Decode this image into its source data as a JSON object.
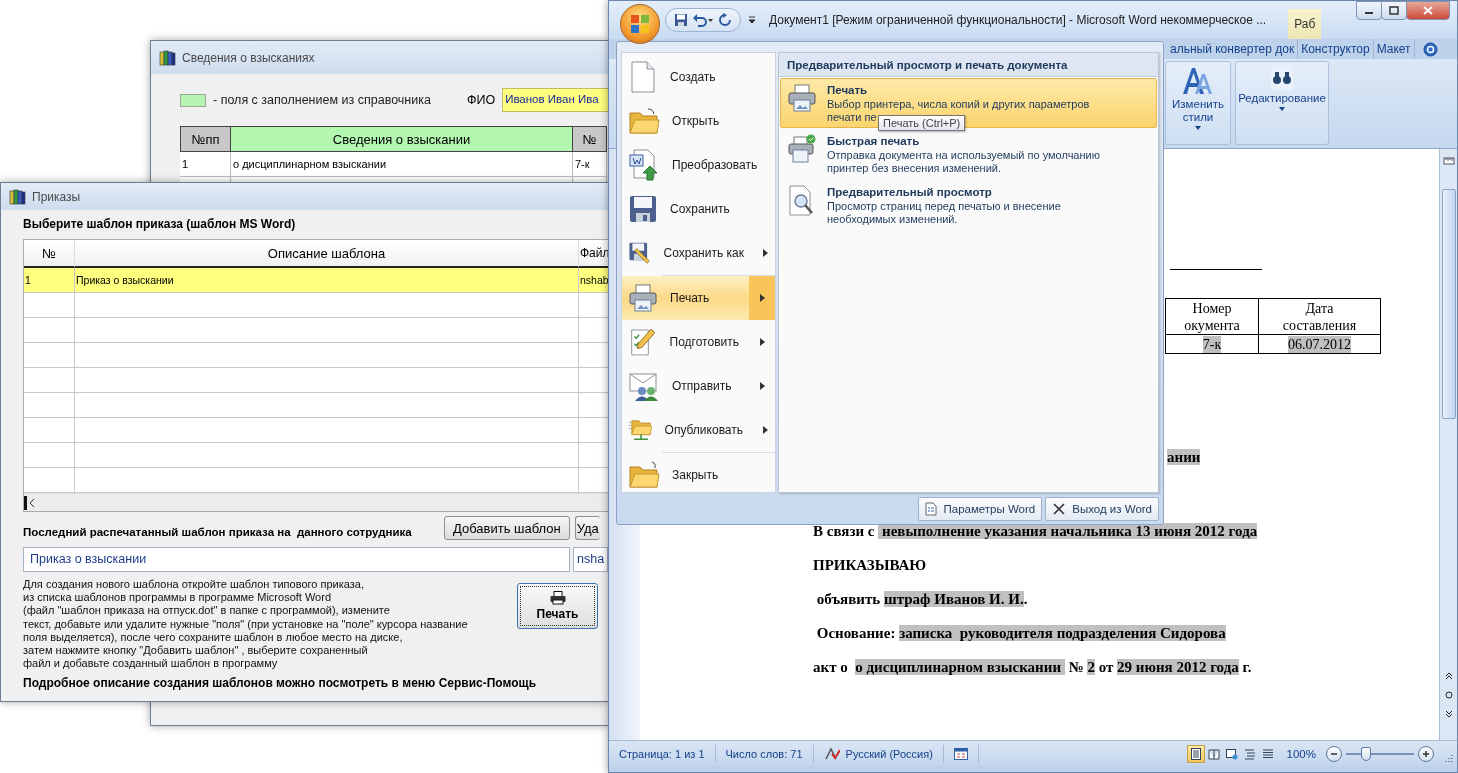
{
  "penalties_window": {
    "title": "Сведения о взысканиях",
    "legend": "- поля с заполнением из справочника",
    "fio_label": "ФИО",
    "fio_value": "Иванов Иван Ива",
    "columns": [
      {
        "label": "№пп",
        "kind": "plain"
      },
      {
        "label": "Сведения о взыскании",
        "kind": "reference"
      },
      {
        "label": "№",
        "kind": "plain"
      }
    ],
    "rows": [
      [
        "1",
        "о дисциплинарном взыскании",
        "7-к"
      ]
    ]
  },
  "orders_window": {
    "title": "Приказы",
    "prompt": "Выберите шаблон приказа (шаблон MS Word)",
    "columns": [
      "№",
      "Описание шаблона",
      "Файл"
    ],
    "rows": [
      {
        "cells": [
          "1",
          "Приказ о взыскании",
          "nshab"
        ],
        "selected": true
      }
    ],
    "last_label": "Последний распечатанный шаблон приказа на  данного сотрудника",
    "buttons": [
      "Добавить шаблон",
      "Уда"
    ],
    "last_template": "Приказ о взыскании",
    "last_file": "nsha",
    "help_lines": [
      "Для создания нового шаблона откройте шаблон типового приказа,",
      "из списка шаблонов программы в программе Microsoft Word",
      "(файл \"шаблон приказа на отпуск.dot\" в папке  с программой),  измените",
      "текст, добавьте или удалите нужные \"поля\" (при установке на \"поле\" курсора название",
      "поля выделяется), после чего сохраните шаблон в любое место на диске,",
      "затем нажмите кнопку \"Добавить шаблон\" , выберите сохраненный",
      "файл и добавьте созданный шаблон в программу"
    ],
    "print_button": "Печать",
    "footer": "Подробное описание создания шаблонов можно посмотреть в меню Сервис-Помощь"
  },
  "word": {
    "title": "Документ1 [Режим ограниченной функциональности] - Microsoft Word некоммерческое ...",
    "context_tab": "Раб",
    "ribbon_tabs": [
      {
        "label": "альный конвертер док",
        "selected": false
      },
      {
        "label": "Конструктор",
        "selected": false
      },
      {
        "label": "Макет",
        "selected": false
      }
    ],
    "ribbon_groups": [
      {
        "label": "Изменить стили",
        "kind": "styles"
      },
      {
        "label": "Редактирование",
        "kind": "find"
      }
    ],
    "office_menu": {
      "items": [
        {
          "label": "Создать",
          "kind": "new",
          "submenu": false,
          "selected": false
        },
        {
          "label": "Открыть",
          "kind": "open",
          "submenu": false,
          "selected": false
        },
        {
          "label": "Преобразовать",
          "kind": "convert",
          "submenu": false,
          "selected": false
        },
        {
          "label": "Сохранить",
          "kind": "save",
          "submenu": false,
          "selected": false
        },
        {
          "label": "Сохранить как",
          "kind": "save_as",
          "submenu": true,
          "selected": false
        },
        {
          "label": "Печать",
          "kind": "print",
          "submenu": true,
          "selected": true
        },
        {
          "label": "Подготовить",
          "kind": "prepare",
          "submenu": true,
          "selected": false
        },
        {
          "label": "Отправить",
          "kind": "send",
          "submenu": true,
          "selected": false
        },
        {
          "label": "Опубликовать",
          "kind": "publish",
          "submenu": true,
          "selected": false
        },
        {
          "label": "Закрыть",
          "kind": "close",
          "submenu": false,
          "selected": false
        }
      ],
      "panel_title": "Предварительный просмотр и печать документа",
      "panel_items": [
        {
          "title": "Печать",
          "kind": "print",
          "description": [
            "Выбор принтера, числа копий и других параметров",
            "печати пе"
          ],
          "selected": true
        },
        {
          "title": "Быстрая печать",
          "kind": "quick_print",
          "description": [
            "Отправка документа на используемый по умолчанию",
            "принтер без внесения изменений."
          ],
          "selected": false
        },
        {
          "title": "Предварительный просмотр",
          "kind": "preview",
          "description": [
            "Просмотр страниц перед печатью и внесение",
            "необходимых изменений."
          ],
          "selected": false
        }
      ],
      "footer_buttons": [
        {
          "label": "Параметры Word",
          "kind": "options"
        },
        {
          "label": "Выход из Word",
          "kind": "exit"
        }
      ],
      "tooltip": "Печать (Ctrl+P)"
    },
    "document": {
      "table": {
        "headers": [
          [
            "Номер",
            "окумента"
          ],
          [
            "Дата",
            "составления"
          ]
        ],
        "cells": [
          {
            "text": "7-к",
            "highlighted": true
          },
          {
            "text": "06.07.2012",
            "highlighted": true
          }
        ]
      },
      "fragment": {
        "text": "ании",
        "highlighted": true
      },
      "paragraphs": [
        {
          "segments": [
            {
              "text": "В связи с ",
              "highlighted": false
            },
            {
              "text": " невыполнение указания начальника 13 июня 2012 года",
              "highlighted": true
            }
          ]
        },
        {
          "segments": [
            {
              "text": "ПРИКАЗЫВАЮ",
              "highlighted": false
            }
          ]
        },
        {
          "segments": [
            {
              "text": " объявить ",
              "highlighted": false
            },
            {
              "text": "штраф Иванов И. И.",
              "highlighted": true
            },
            {
              "text": ".",
              "highlighted": false
            }
          ]
        },
        {
          "segments": [
            {
              "text": " Основание: ",
              "highlighted": false
            },
            {
              "text": "записка  руководителя подразделения Сидорова",
              "highlighted": true
            }
          ]
        },
        {
          "segments": [
            {
              "text": "акт о  ",
              "highlighted": false
            },
            {
              "text": "о дисциплинарном взыскании ",
              "highlighted": true
            },
            {
              "text": " № ",
              "highlighted": false
            },
            {
              "text": "2",
              "highlighted": true
            },
            {
              "text": " от ",
              "highlighted": false
            },
            {
              "text": "29 июня 2012 года",
              "highlighted": true
            },
            {
              "text": " г.",
              "highlighted": false
            }
          ]
        }
      ]
    },
    "status_bar": {
      "items": [
        "Страница: 1 из 1",
        "Число слов: 71",
        "Русский (Россия)"
      ],
      "views": [
        {
          "kind": "print_layout",
          "selected": true
        },
        {
          "kind": "reading",
          "selected": false
        },
        {
          "kind": "web",
          "selected": false
        },
        {
          "kind": "outline",
          "selected": false
        },
        {
          "kind": "draft",
          "selected": false
        }
      ],
      "zoom": "100%",
      "zoom_level": {
        "level": 0.3
      }
    }
  }
}
